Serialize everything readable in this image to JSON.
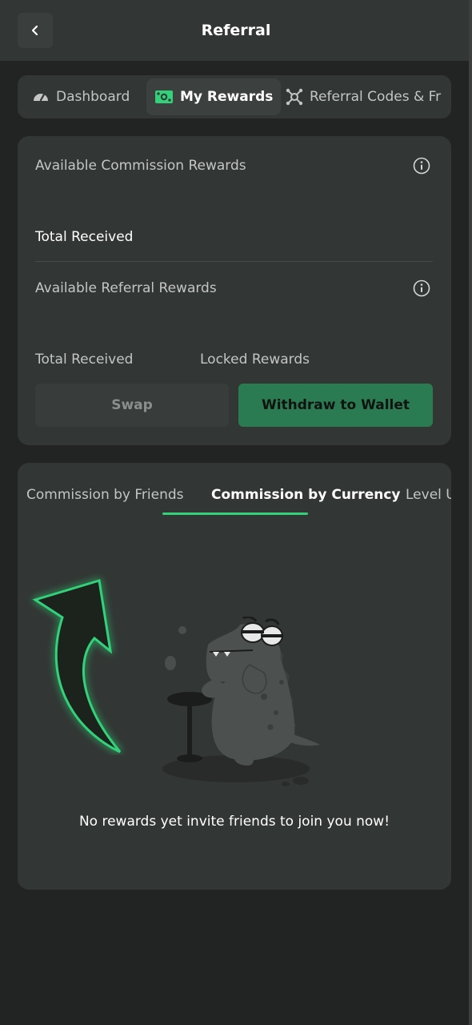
{
  "header": {
    "title": "Referral",
    "back_icon": "chevron-left-icon"
  },
  "tabs": [
    {
      "label": "Dashboard",
      "icon": "speedometer-icon",
      "active": false
    },
    {
      "label": "My Rewards",
      "icon": "cash-icon",
      "active": true
    },
    {
      "label": "Referral Codes & Fr",
      "icon": "network-icon",
      "active": false
    }
  ],
  "rewards": {
    "commission_label": "Available Commission Rewards",
    "commission_total_label": "Total Received",
    "referral_label": "Available Referral Rewards",
    "referral_total_label": "Total Received",
    "locked_label": "Locked Rewards",
    "swap_label": "Swap",
    "withdraw_label": "Withdraw to Wallet"
  },
  "commission_tabs": [
    {
      "label": "Commission by Friends",
      "active": false
    },
    {
      "label": "Commission by Currency",
      "active": true
    },
    {
      "label": "Level U",
      "active": false
    }
  ],
  "empty_state": {
    "message": "No rewards yet invite friends to join you now!"
  },
  "colors": {
    "accent": "#33d17a",
    "button_green": "#2b7b52",
    "panel": "#323634",
    "background": "#222423"
  }
}
